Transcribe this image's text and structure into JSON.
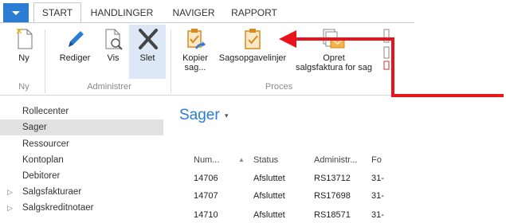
{
  "tabs": {
    "items": [
      {
        "label": "START"
      },
      {
        "label": "HANDLINGER"
      },
      {
        "label": "NAVIGER"
      },
      {
        "label": "RAPPORT"
      }
    ]
  },
  "ribbon": {
    "buttons": {
      "new": {
        "label": "Ny",
        "icon": "new-document-icon"
      },
      "edit": {
        "label": "Rediger",
        "icon": "pencil-icon"
      },
      "view": {
        "label": "Vis",
        "icon": "view-document-icon"
      },
      "delete": {
        "label": "Slet",
        "icon": "delete-x-icon"
      },
      "copy_job_line1": {
        "label": "Kopier"
      },
      "copy_job_line2": {
        "label": "sag..."
      },
      "job_tasks": {
        "label": "Sagsopgavelinjer",
        "icon": "clipboard-check-icon"
      },
      "create_invoice_line1": {
        "label": "Opret"
      },
      "create_invoice_line2": {
        "label": "salgsfaktura for sag"
      }
    },
    "groups": {
      "new": "Ny",
      "manage": "Administrer",
      "process": "Proces"
    }
  },
  "navigation": {
    "items": [
      {
        "label": "Rollecenter",
        "expandable": false
      },
      {
        "label": "Sager",
        "expandable": false,
        "selected": true
      },
      {
        "label": "Ressourcer",
        "expandable": false
      },
      {
        "label": "Kontoplan",
        "expandable": false
      },
      {
        "label": "Debitorer",
        "expandable": false
      },
      {
        "label": "Salgsfakturaer",
        "expandable": true
      },
      {
        "label": "Salgskreditnotaer",
        "expandable": true
      }
    ]
  },
  "page": {
    "title": "Sager"
  },
  "table": {
    "columns": [
      "Num...",
      "Status",
      "Administr...",
      "Fo"
    ],
    "rows": [
      [
        "14706",
        "Afsluttet",
        "RS13712",
        "31-"
      ],
      [
        "14707",
        "Afsluttet",
        "RS17698",
        "31-"
      ],
      [
        "14710",
        "Afsluttet",
        "RS18571",
        "31-"
      ]
    ]
  },
  "colors": {
    "accent": "#2b7cd3",
    "annotation_arrow": "#e8141b",
    "selected_nav": "#e1e1e1"
  }
}
